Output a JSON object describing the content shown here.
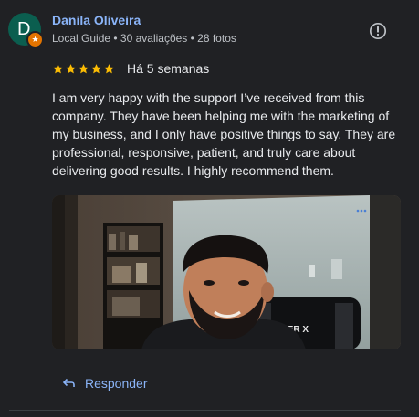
{
  "reviewer": {
    "initial": "D",
    "name": "Danila Oliveira",
    "meta": "Local Guide • 30 avaliações • 28 fotos",
    "badge_icon": "star-badge-icon"
  },
  "rating": {
    "stars": 5,
    "max": 5,
    "date": "Há 5 semanas"
  },
  "review": {
    "text": "I am very happy with the support I’ve received from this company. They have been helping me with the marketing of my business, and I only have positive things to say. They are professional, responsive, patient, and truly care about delivering good results. I highly recommend them."
  },
  "photo": {
    "chair_text": "RACER X",
    "overlay_icon": "more-dots-icon"
  },
  "actions": {
    "reply_label": "Responder",
    "report_icon": "report-icon"
  },
  "colors": {
    "background": "#202124",
    "link": "#8ab4f8",
    "star": "#fbbc04",
    "avatar": "#0b5e4f",
    "badge": "#e37400"
  }
}
